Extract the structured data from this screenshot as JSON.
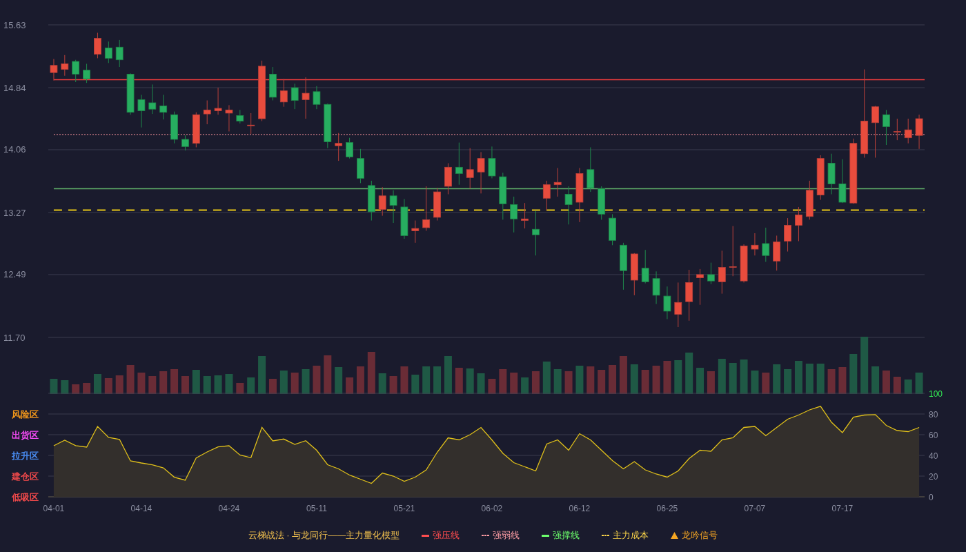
{
  "price_chart": {
    "chart_data": {
      "type": "candlestick",
      "categories": [
        null,
        null,
        null,
        null,
        null,
        null,
        null,
        null,
        null,
        null,
        null,
        null,
        null,
        null,
        null,
        null,
        null,
        null,
        null,
        null,
        null,
        null,
        null,
        null,
        null,
        null,
        null,
        null,
        null,
        null,
        null,
        null,
        null,
        null,
        null,
        null,
        null,
        null,
        null,
        null,
        null,
        null,
        null,
        null,
        null,
        null,
        null,
        null,
        null,
        null,
        null,
        null,
        null,
        null,
        null,
        null,
        null,
        null,
        null,
        null,
        null,
        null,
        null,
        null,
        null,
        null,
        null,
        null,
        null,
        null,
        null,
        null,
        null,
        null,
        null,
        null,
        null,
        null,
        null,
        null
      ],
      "ylim": [
        11.7,
        15.63
      ],
      "grid": true,
      "yticks": [
        {
          "value": 15.63,
          "label": "15.63"
        },
        {
          "value": 14.84,
          "label": "14.84"
        },
        {
          "value": 14.06,
          "label": "14.06"
        },
        {
          "value": 13.27,
          "label": "13.27"
        },
        {
          "value": 12.49,
          "label": "12.49"
        },
        {
          "value": 11.7,
          "label": "11.70"
        }
      ],
      "ohlc": [
        [
          15.03,
          15.2,
          14.93,
          15.12
        ],
        [
          15.07,
          15.25,
          14.99,
          15.14
        ],
        [
          15.17,
          15.19,
          14.91,
          15.01
        ],
        [
          15.06,
          15.14,
          14.9,
          14.95
        ],
        [
          15.26,
          15.53,
          15.21,
          15.46
        ],
        [
          15.34,
          15.42,
          15.15,
          15.21
        ],
        [
          15.35,
          15.44,
          15.1,
          15.19
        ],
        [
          15.01,
          15.02,
          14.5,
          14.53
        ],
        [
          14.69,
          14.75,
          14.34,
          14.55
        ],
        [
          14.65,
          14.88,
          14.51,
          14.57
        ],
        [
          14.61,
          14.75,
          14.44,
          14.53
        ],
        [
          14.5,
          14.54,
          14.14,
          14.19
        ],
        [
          14.19,
          14.24,
          14.05,
          14.1
        ],
        [
          14.14,
          14.53,
          14.09,
          14.5
        ],
        [
          14.51,
          14.68,
          14.38,
          14.56
        ],
        [
          14.55,
          14.84,
          14.5,
          14.58
        ],
        [
          14.52,
          14.62,
          14.29,
          14.56
        ],
        [
          14.49,
          14.56,
          14.39,
          14.42
        ],
        [
          14.36,
          14.52,
          14.26,
          14.37
        ],
        [
          14.45,
          15.18,
          14.42,
          15.11
        ],
        [
          15.01,
          15.1,
          14.68,
          14.72
        ],
        [
          14.66,
          14.95,
          14.6,
          14.8
        ],
        [
          14.84,
          14.89,
          14.57,
          14.68
        ],
        [
          14.69,
          14.97,
          14.45,
          14.77
        ],
        [
          14.79,
          14.86,
          14.57,
          14.63
        ],
        [
          14.63,
          14.64,
          14.08,
          14.16
        ],
        [
          14.11,
          14.27,
          13.92,
          14.14
        ],
        [
          14.15,
          14.21,
          13.95,
          13.97
        ],
        [
          13.95,
          14.07,
          13.64,
          13.7
        ],
        [
          13.61,
          13.67,
          13.17,
          13.28
        ],
        [
          13.31,
          13.59,
          13.23,
          13.48
        ],
        [
          13.48,
          13.55,
          13.14,
          13.36
        ],
        [
          13.34,
          13.44,
          12.94,
          12.98
        ],
        [
          13.04,
          13.17,
          12.89,
          13.07
        ],
        [
          13.08,
          13.6,
          13.04,
          13.18
        ],
        [
          13.21,
          13.58,
          13.17,
          13.53
        ],
        [
          13.6,
          13.89,
          13.5,
          13.84
        ],
        [
          13.84,
          14.15,
          13.62,
          13.76
        ],
        [
          13.71,
          14.08,
          13.57,
          13.81
        ],
        [
          13.78,
          14.03,
          13.51,
          13.95
        ],
        [
          13.95,
          14.1,
          13.7,
          13.73
        ],
        [
          13.72,
          13.77,
          13.18,
          13.38
        ],
        [
          13.37,
          13.47,
          13.02,
          13.19
        ],
        [
          13.17,
          13.39,
          13.07,
          13.19
        ],
        [
          13.06,
          13.29,
          12.73,
          12.99
        ],
        [
          13.45,
          13.67,
          13.3,
          13.62
        ],
        [
          13.62,
          13.83,
          13.47,
          13.65
        ],
        [
          13.5,
          13.6,
          13.12,
          13.37
        ],
        [
          13.4,
          13.83,
          13.15,
          13.76
        ],
        [
          13.81,
          14.09,
          13.53,
          13.58
        ],
        [
          13.57,
          13.6,
          13.18,
          13.25
        ],
        [
          13.2,
          13.25,
          12.86,
          12.92
        ],
        [
          12.86,
          12.89,
          12.3,
          12.54
        ],
        [
          12.42,
          12.76,
          12.23,
          12.75
        ],
        [
          12.57,
          12.8,
          12.38,
          12.4
        ],
        [
          12.44,
          12.53,
          12.12,
          12.23
        ],
        [
          12.22,
          12.34,
          11.93,
          12.03
        ],
        [
          11.99,
          12.39,
          11.83,
          12.14
        ],
        [
          12.15,
          12.55,
          11.91,
          12.39
        ],
        [
          12.45,
          12.56,
          12.11,
          12.49
        ],
        [
          12.49,
          12.64,
          12.37,
          12.41
        ],
        [
          12.4,
          12.79,
          12.25,
          12.58
        ],
        [
          12.58,
          13.1,
          12.47,
          12.59
        ],
        [
          12.41,
          12.87,
          12.39,
          12.85
        ],
        [
          12.81,
          13.01,
          12.73,
          12.86
        ],
        [
          12.88,
          13.08,
          12.65,
          12.73
        ],
        [
          12.66,
          12.98,
          12.54,
          12.9
        ],
        [
          12.91,
          13.2,
          12.78,
          13.11
        ],
        [
          13.11,
          13.34,
          12.91,
          13.24
        ],
        [
          13.22,
          13.67,
          13.18,
          13.55
        ],
        [
          13.49,
          13.99,
          13.43,
          13.95
        ],
        [
          13.89,
          14.01,
          13.5,
          13.63
        ],
        [
          13.63,
          13.94,
          13.39,
          13.4
        ],
        [
          13.39,
          14.2,
          13.38,
          14.14
        ],
        [
          14.01,
          15.07,
          13.96,
          14.42
        ],
        [
          14.4,
          14.61,
          13.96,
          14.6
        ],
        [
          14.5,
          14.56,
          14.12,
          14.35
        ],
        [
          14.28,
          14.45,
          14.18,
          14.29
        ],
        [
          14.21,
          14.45,
          14.14,
          14.31
        ],
        [
          14.24,
          14.5,
          14.07,
          14.45
        ]
      ],
      "ref_lines": [
        {
          "axis": "y",
          "value": 14.94,
          "color": "#f23c3c"
        },
        {
          "axis": "y",
          "value": 14.25,
          "color": "#b8707c"
        },
        {
          "axis": "y",
          "value": 13.57,
          "color": "#5fae6a"
        },
        {
          "axis": "y",
          "value": 13.3,
          "color": "#e6c619"
        }
      ]
    }
  },
  "oscillator": {
    "zones": [
      {
        "label": "风险区",
        "color": "#ff9f1a"
      },
      {
        "label": "出货区",
        "color": "#ff4dff"
      },
      {
        "label": "拉升区",
        "color": "#4d94ff"
      },
      {
        "label": "建仓区",
        "color": "#ff4d4d"
      },
      {
        "label": "低吸区",
        "color": "#ff4d4d"
      }
    ],
    "chart_data": {
      "type": "area",
      "categories": [
        "04-01",
        null,
        null,
        null,
        null,
        null,
        null,
        null,
        "04-14",
        null,
        null,
        null,
        null,
        null,
        null,
        null,
        "04-24",
        null,
        null,
        null,
        null,
        null,
        null,
        null,
        "05-11",
        null,
        null,
        null,
        null,
        null,
        null,
        null,
        "05-21",
        null,
        null,
        null,
        null,
        null,
        null,
        null,
        "06-02",
        null,
        null,
        null,
        null,
        null,
        null,
        null,
        "06-12",
        null,
        null,
        null,
        null,
        null,
        null,
        null,
        "06-25",
        null,
        null,
        null,
        null,
        null,
        null,
        null,
        "07-07",
        null,
        null,
        null,
        null,
        null,
        null,
        null,
        "07-17",
        null,
        null,
        null,
        null,
        null,
        null,
        null
      ],
      "ylim": [
        0,
        100
      ],
      "grid": true,
      "yticks": [
        {
          "value": 0,
          "label": "0"
        },
        {
          "value": 20,
          "label": "20"
        },
        {
          "value": 40,
          "label": "40"
        },
        {
          "value": 60,
          "label": "60"
        },
        {
          "value": 80,
          "label": "80"
        },
        {
          "value": 100,
          "label": "100"
        }
      ],
      "series": [
        {
          "color": "#e0c01a",
          "values": [
            49.3,
            54.7,
            49.5,
            48,
            68,
            57.3,
            55.5,
            34.7,
            32.7,
            30.9,
            28,
            18.9,
            16,
            37.5,
            43.3,
            48.2,
            49.3,
            40.4,
            37.8,
            67.1,
            54,
            55.8,
            50.7,
            54.2,
            45,
            31,
            27,
            21,
            17,
            13,
            23,
            20,
            15,
            19,
            26,
            43,
            57,
            55,
            60,
            67,
            55,
            42,
            33,
            29,
            25,
            51,
            55,
            45,
            61,
            55,
            45,
            35,
            27,
            34,
            26,
            22,
            19,
            25,
            37,
            45,
            44,
            55,
            57,
            67,
            68,
            59,
            67,
            75,
            79,
            84,
            87.5,
            72,
            62,
            77,
            79,
            79.5,
            69,
            64,
            63,
            67
          ]
        }
      ]
    }
  },
  "legend": {
    "title": "云梯战法 · 与龙同行——主力量化模型",
    "items": [
      {
        "label": "强压线",
        "kind": "solid",
        "color": "#ff4d4f"
      },
      {
        "label": "强弱线",
        "kind": "dotted",
        "color": "#ff9ea5"
      },
      {
        "label": "强撑线",
        "kind": "solid",
        "color": "#6cff6c"
      },
      {
        "label": "主力成本",
        "kind": "dashed",
        "color": "#ffd84a"
      },
      {
        "label": "龙吟信号",
        "kind": "triangle",
        "color": "#f5a623"
      }
    ]
  }
}
